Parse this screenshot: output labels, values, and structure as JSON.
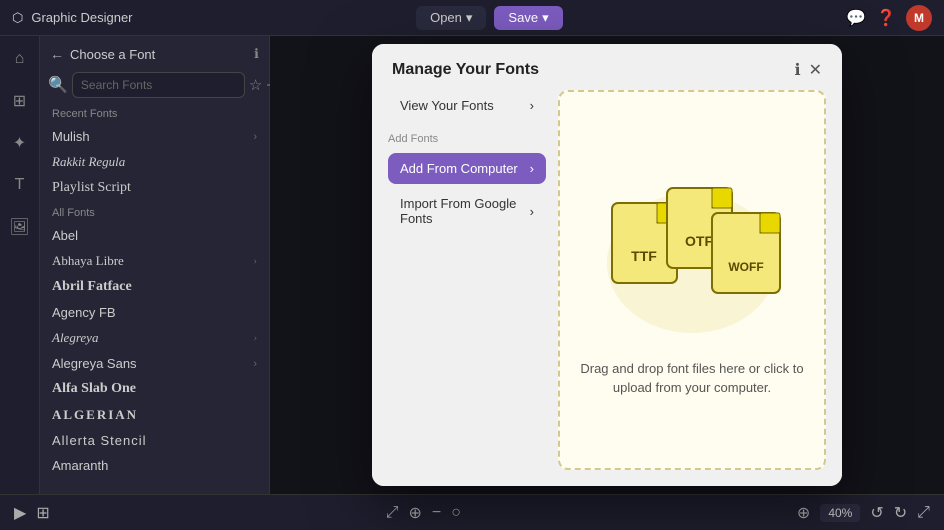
{
  "app": {
    "title": "Graphic Designer"
  },
  "topbar": {
    "open_label": "Open",
    "save_label": "Save",
    "avatar_initials": "M"
  },
  "font_panel": {
    "title": "Choose a Font",
    "search_placeholder": "Search Fonts",
    "recent_label": "Recent Fonts",
    "all_label": "All Fonts",
    "recent_fonts": [
      {
        "name": "Mulish",
        "style": "font-mulish",
        "has_submenu": true
      },
      {
        "name": "Rakkit Regula",
        "style": "font-rakkit",
        "has_submenu": false
      },
      {
        "name": "Playlist Script",
        "style": "font-playlist",
        "has_submenu": false
      }
    ],
    "all_fonts": [
      {
        "name": "Abel",
        "style": "font-abel",
        "has_submenu": false
      },
      {
        "name": "Abhaya Libre",
        "style": "font-abhaya",
        "has_submenu": true
      },
      {
        "name": "Abril Fatface",
        "style": "font-abril",
        "has_submenu": false
      },
      {
        "name": "Agency FB",
        "style": "font-agency",
        "has_submenu": false
      },
      {
        "name": "Alegreya",
        "style": "font-alegreya",
        "has_submenu": true
      },
      {
        "name": "Alegreya Sans",
        "style": "font-alegreyasans",
        "has_submenu": true
      },
      {
        "name": "Alfa Slab One",
        "style": "font-alfaslab",
        "has_submenu": false
      },
      {
        "name": "ALGERIAN",
        "style": "font-algerian",
        "has_submenu": false
      },
      {
        "name": "Allerta Stencil",
        "style": "font-allerta",
        "has_submenu": false
      },
      {
        "name": "Amaranth",
        "style": "font-amaranth",
        "has_submenu": false
      }
    ]
  },
  "modal": {
    "title": "Manage Your Fonts",
    "view_fonts_label": "View Your Fonts",
    "add_fonts_label": "Add Fonts",
    "add_from_computer_label": "Add From Computer",
    "import_google_label": "Import From Google Fonts",
    "drop_text": "Drag and drop font files here or click to upload from your computer.",
    "info_icon": "ℹ",
    "close_icon": "✕",
    "chevron": "›"
  },
  "bottombar": {
    "zoom_label": "40%"
  }
}
